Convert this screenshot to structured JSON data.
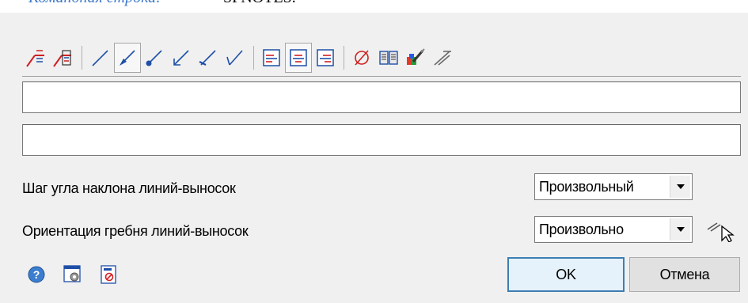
{
  "command_line": {
    "prompt": "Командная строка:",
    "command": "SPNOTES."
  },
  "toolbar": {
    "buttons": [
      {
        "icon": "leader-text-edit-icon"
      },
      {
        "icon": "leader-text-copy-icon"
      },
      {
        "icon": "leader-line-none-icon"
      },
      {
        "icon": "leader-line-arrow-icon",
        "pressed": true
      },
      {
        "icon": "leader-line-dot-icon"
      },
      {
        "icon": "leader-line-open-arrow-icon"
      },
      {
        "icon": "leader-line-tick-icon"
      },
      {
        "icon": "leader-line-check-icon"
      },
      {
        "icon": "align-left-icon"
      },
      {
        "icon": "align-center-icon",
        "pressed": true
      },
      {
        "icon": "align-right-icon"
      },
      {
        "icon": "diameter-symbol-icon"
      },
      {
        "icon": "library-book-icon"
      },
      {
        "icon": "color-brush-icon"
      },
      {
        "icon": "leader-pick-icon"
      }
    ]
  },
  "fields": {
    "text_line_1": "",
    "text_line_2": ""
  },
  "settings": {
    "angle_step_label": "Шаг угла наклона линий-выносок",
    "angle_step_value": "Произвольный",
    "shelf_orientation_label": "Ориентация гребня линий-выносок",
    "shelf_orientation_value": "Произвольно"
  },
  "buttons": {
    "ok": "OK",
    "cancel": "Отмена"
  },
  "colors": {
    "icon_red": "#d02020",
    "icon_blue": "#1e4fa8",
    "accent": "#3c7fb1"
  }
}
